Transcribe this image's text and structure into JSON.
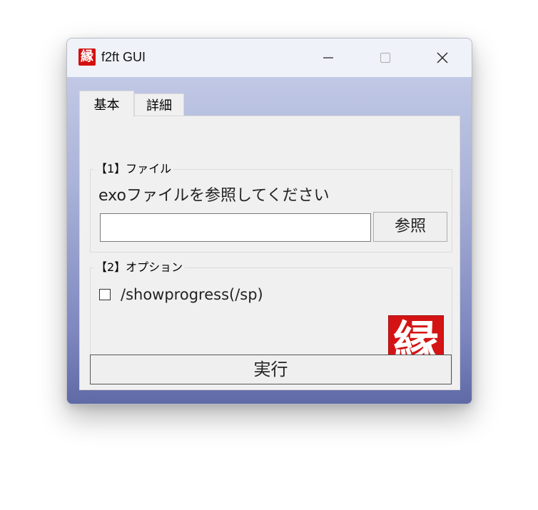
{
  "window": {
    "title": "f2ft GUI",
    "icon_char": "縁",
    "icon_name": "app-logo-icon",
    "controls": [
      "minimize-icon",
      "maximize-icon",
      "close-icon"
    ]
  },
  "tabs": [
    {
      "label": "基本",
      "active": true
    },
    {
      "label": "詳細",
      "active": false
    }
  ],
  "file_section": {
    "legend": "【1】ファイル",
    "instruction": "exoファイルを参照してください",
    "path_value": "",
    "browse_label": "参照"
  },
  "options_section": {
    "legend": "【2】オプション",
    "showprogress_label": "/showprogress(/sp)",
    "showprogress_checked": false,
    "badge_char": "縁"
  },
  "run_label": "実行",
  "colors": {
    "accent_red": "#d41414",
    "gradient_top": "#c9d0ea",
    "gradient_bottom": "#5f6aa6"
  }
}
